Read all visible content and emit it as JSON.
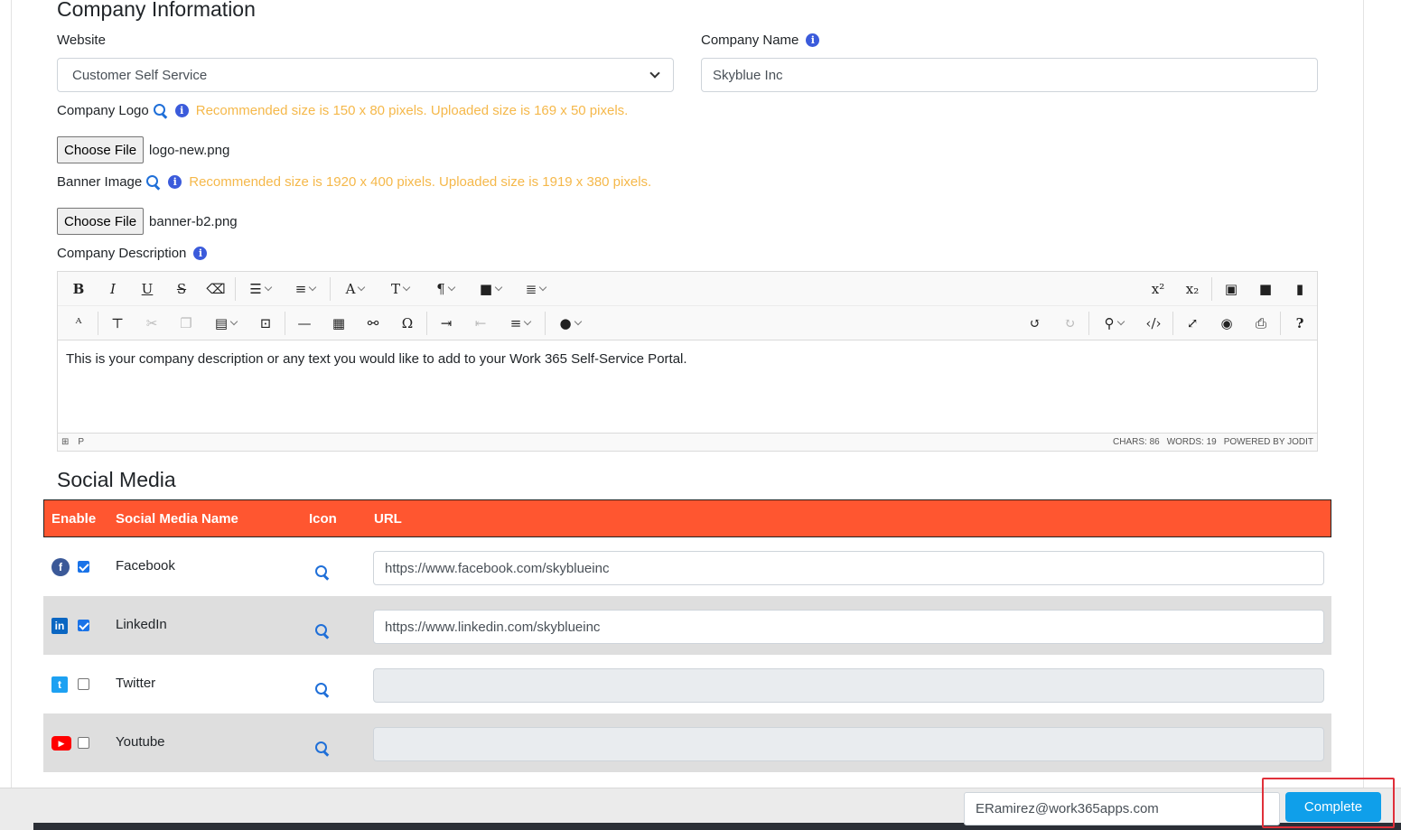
{
  "company_info": {
    "title": "Company Information",
    "website_label": "Website",
    "website_value": "Customer Self Service",
    "company_name_label": "Company Name",
    "company_name_value": "Skyblue Inc",
    "logo_label": "Company Logo",
    "logo_hint": "Recommended size is 150 x 80 pixels. Uploaded size is 169 x 50 pixels.",
    "logo_button": "Choose File",
    "logo_file": "logo-new.png",
    "banner_label": "Banner Image",
    "banner_hint": "Recommended size is 1920 x 400 pixels. Uploaded size is 1919 x 380 pixels.",
    "banner_button": "Choose File",
    "banner_file": "banner-b2.png",
    "description_label": "Company Description"
  },
  "editor": {
    "content": "This is your company description or any text you would like to add to your Work 365 Self-Service Portal.",
    "status_path": "P",
    "chars": "CHARS: 86",
    "words": "WORDS: 19",
    "powered": "POWERED BY JODIT"
  },
  "social_media": {
    "title": "Social Media",
    "columns": [
      "Enable",
      "Social Media Name",
      "Icon",
      "URL"
    ],
    "rows": [
      {
        "name": "Facebook",
        "enabled": true,
        "url": "https://www.facebook.com/skyblueinc",
        "brand_color": "#3b5998"
      },
      {
        "name": "LinkedIn",
        "enabled": true,
        "url": "https://www.linkedin.com/skyblueinc",
        "brand_color": "#0a66c2"
      },
      {
        "name": "Twitter",
        "enabled": false,
        "url": "",
        "brand_color": "#1da1f2"
      },
      {
        "name": "Youtube",
        "enabled": false,
        "url": "",
        "brand_color": "#ff0000"
      }
    ]
  },
  "footer": {
    "email": "ERamirez@work365apps.com",
    "complete_label": "Complete"
  },
  "colors": {
    "accent": "#ff5630",
    "button": "#0f9fea",
    "hint": "#f5b84a",
    "highlight": "#e0303a"
  }
}
